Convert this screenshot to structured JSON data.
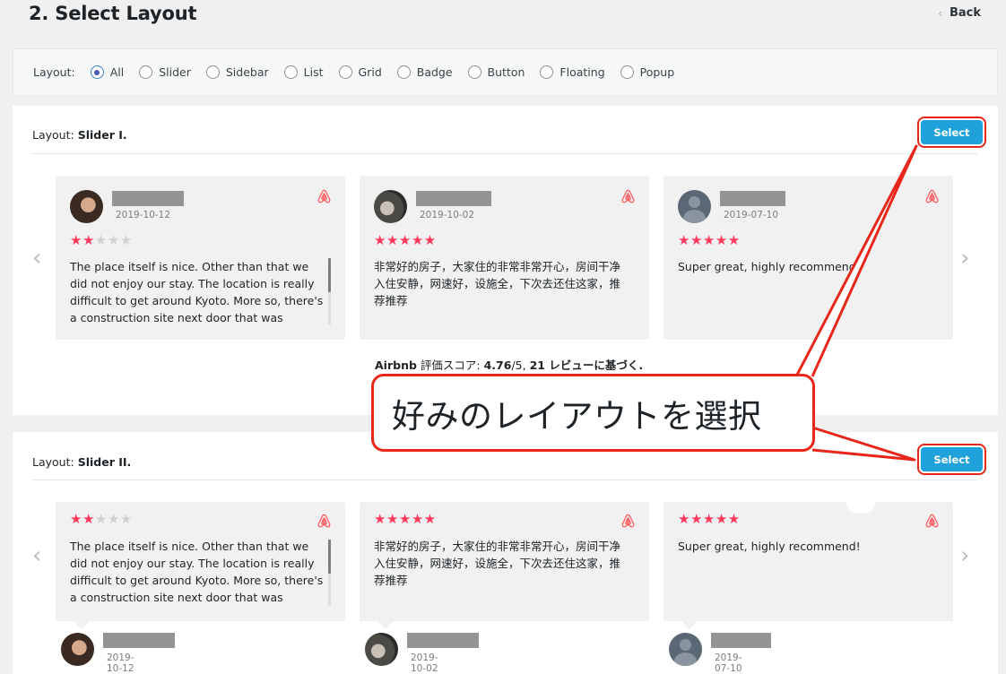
{
  "page": {
    "title": "2. Select Layout",
    "back_label": "Back"
  },
  "filter": {
    "label": "Layout:",
    "options": [
      "All",
      "Slider",
      "Sidebar",
      "List",
      "Grid",
      "Badge",
      "Button",
      "Floating",
      "Popup"
    ],
    "selected": "All"
  },
  "panels": [
    {
      "label_prefix": "Layout:",
      "label_name": "Slider I.",
      "select_label": "Select"
    },
    {
      "label_prefix": "Layout:",
      "label_name": "Slider II.",
      "select_label": "Select"
    }
  ],
  "reviews": [
    {
      "date": "2019-10-12",
      "rating": 2,
      "text": "The place itself is nice. Other than that we did not enjoy our stay. The location is really difficult to get around Kyoto. More so, there's a construction site next door that was"
    },
    {
      "date": "2019-10-02",
      "rating": 5,
      "text": "非常好的房子，大家住的非常非常开心，房间干净入住安静，网速好，设施全，下次去还住这家，推荐推荐"
    },
    {
      "date": "2019-07-10",
      "rating": 5,
      "text": "Super great, highly recommend!"
    }
  ],
  "rating_summary": {
    "brand": "Airbnb",
    "label": " 評価スコア: ",
    "score": "4.76",
    "out_of": "/5, ",
    "count": "21",
    "suffix": " レビューに基づく."
  },
  "callout": {
    "text": "好みのレイアウトを選択"
  },
  "colors": {
    "accent_button": "#1fa1db",
    "star": "#ff385c",
    "callout_border": "#e8271a",
    "airbnb": "#ff5a5f"
  }
}
